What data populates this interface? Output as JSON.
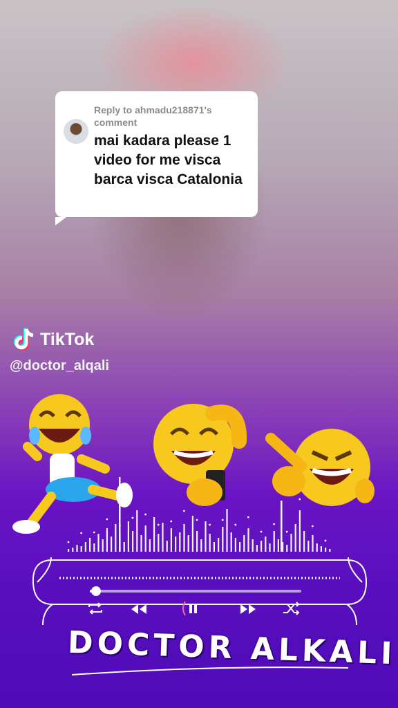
{
  "reply": {
    "meta": "Reply to ahmadu218871's comment",
    "message": "mai kadara please 1 video for me visca barca visca Catalonia"
  },
  "watermark": {
    "brand": "TikTok",
    "handle": "@doctor_alqali"
  },
  "overlay": {
    "title": "DOCTOR ALKALI"
  },
  "player": {
    "progress": 0.03
  },
  "icons": [
    "repeat-icon",
    "rewind-icon",
    "pause-icon",
    "fast-forward-icon",
    "shuffle-icon"
  ],
  "colors": {
    "background": "#5a0fb0",
    "accent": "#ffffff",
    "tiktok_cyan": "#25f4ee",
    "tiktok_red": "#fe2c55"
  }
}
